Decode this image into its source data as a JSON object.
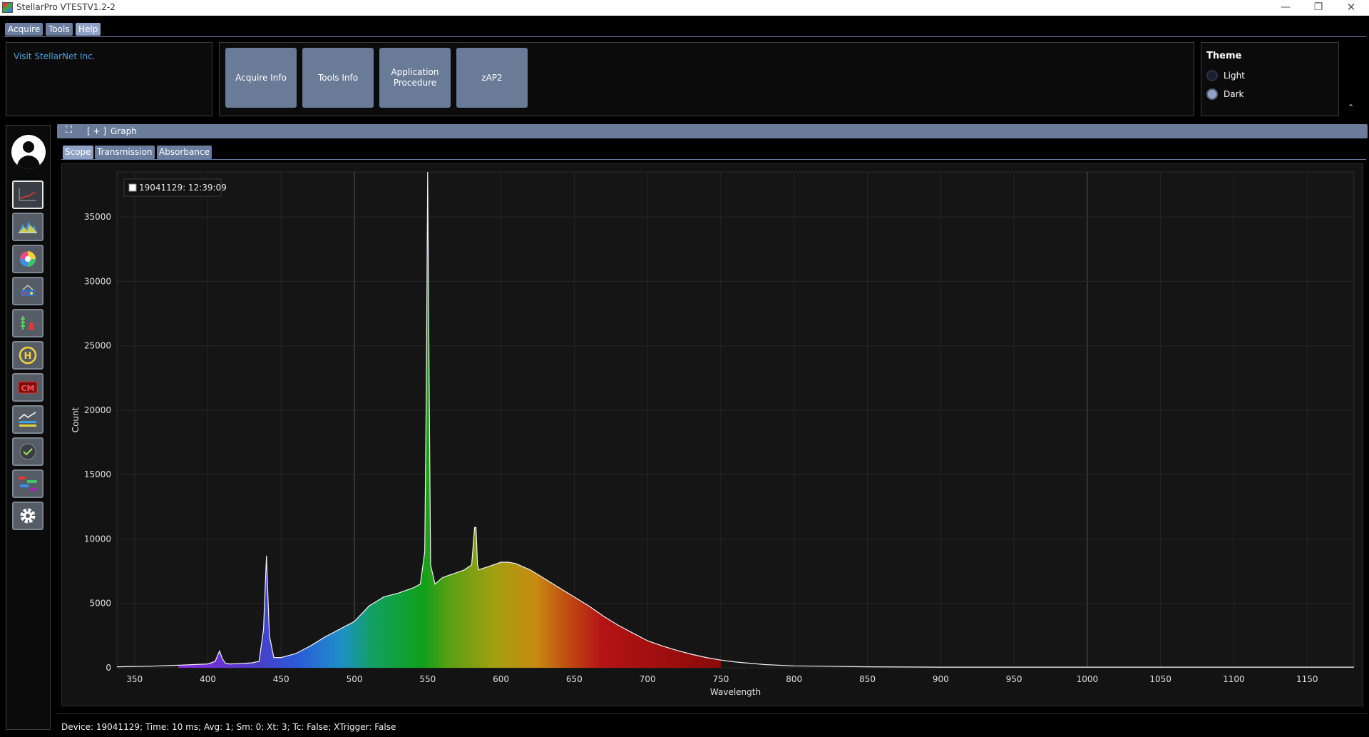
{
  "window": {
    "title": "StellarPro VTESTV1.2-2",
    "minimize": "—",
    "maximize": "❐",
    "close": "✕"
  },
  "menu": {
    "tabs": [
      {
        "label": "Acquire",
        "active": false
      },
      {
        "label": "Tools",
        "active": false
      },
      {
        "label": "Help",
        "active": true
      }
    ]
  },
  "ribbon": {
    "link": "Visit StellarNet Inc.",
    "buttons": [
      {
        "label": "Acquire Info"
      },
      {
        "label": "Tools Info"
      },
      {
        "label": "Application\nProcedure"
      },
      {
        "label": "zAP2"
      }
    ],
    "theme": {
      "title": "Theme",
      "options": [
        {
          "label": "Light",
          "selected": false
        },
        {
          "label": "Dark",
          "selected": true
        }
      ]
    },
    "collapse": "⌃"
  },
  "toolbar": {
    "items": [
      {
        "icon": "scope-graph-icon",
        "active": true
      },
      {
        "icon": "spectrum-peaks-icon",
        "active": false
      },
      {
        "icon": "color-wheel-icon",
        "active": false
      },
      {
        "icon": "lamp-source-icon",
        "active": false
      },
      {
        "icon": "chemistry-flask-icon",
        "active": false
      },
      {
        "icon": "helicopter-h-icon",
        "active": false
      },
      {
        "icon": "cm-badge-icon",
        "active": false
      },
      {
        "icon": "trend-chart-icon",
        "active": false
      },
      {
        "icon": "check-gauge-icon",
        "active": false
      },
      {
        "icon": "timeline-icon",
        "active": false
      },
      {
        "icon": "gear-icon",
        "active": false
      }
    ]
  },
  "graph": {
    "expand_icon": "⛶",
    "plus_label": "[ + ]",
    "title": "Graph",
    "tabs": [
      {
        "label": "Scope",
        "active": true
      },
      {
        "label": "Transmission",
        "active": false
      },
      {
        "label": "Absorbance",
        "active": false
      }
    ]
  },
  "status": {
    "text": "Device: 19041129; Time: 10 ms; Avg: 1; Sm: 0; Xt: 3; Tc: False; XTrigger: False"
  },
  "chart_data": {
    "type": "area",
    "title": "",
    "xlabel": "Wavelength",
    "ylabel": "Count",
    "xlim": [
      338,
      1182
    ],
    "ylim": [
      0,
      38500
    ],
    "x_ticks": [
      350,
      400,
      450,
      500,
      550,
      600,
      650,
      700,
      750,
      800,
      850,
      900,
      950,
      1000,
      1050,
      1100,
      1150
    ],
    "y_ticks": [
      0,
      5000,
      10000,
      15000,
      20000,
      25000,
      30000,
      35000
    ],
    "grid": true,
    "legend": "top-left",
    "series": [
      {
        "name": "19041129:  12:39:09",
        "x": [
          338,
          360,
          380,
          400,
          405,
          408,
          410,
          412,
          415,
          420,
          430,
          435,
          438,
          440,
          442,
          445,
          450,
          460,
          470,
          480,
          490,
          500,
          510,
          520,
          530,
          540,
          545,
          548,
          549,
          550,
          551,
          552,
          555,
          560,
          565,
          570,
          575,
          580,
          582,
          583,
          584,
          585,
          587,
          590,
          600,
          605,
          610,
          620,
          630,
          640,
          650,
          660,
          670,
          680,
          690,
          700,
          710,
          720,
          730,
          740,
          750,
          760,
          780,
          800,
          850,
          900,
          1000,
          1100,
          1182
        ],
        "y": [
          80,
          120,
          200,
          300,
          500,
          1300,
          700,
          350,
          300,
          320,
          380,
          500,
          3000,
          8700,
          2500,
          800,
          800,
          1100,
          1700,
          2400,
          3000,
          3600,
          4800,
          5500,
          5800,
          6200,
          6500,
          9000,
          21000,
          38500,
          22000,
          8000,
          6500,
          7000,
          7200,
          7400,
          7600,
          8000,
          10900,
          10900,
          8000,
          7600,
          7700,
          7800,
          8200,
          8200,
          8100,
          7600,
          6900,
          6200,
          5500,
          4800,
          4000,
          3300,
          2700,
          2100,
          1700,
          1350,
          1050,
          800,
          600,
          450,
          250,
          150,
          80,
          50,
          50,
          50,
          50
        ]
      }
    ]
  }
}
